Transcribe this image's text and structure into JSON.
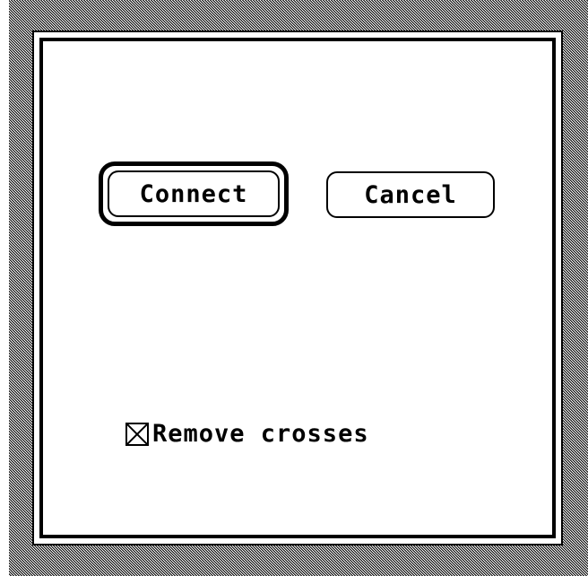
{
  "dialog": {
    "buttons": {
      "connect_label": "Connect",
      "cancel_label": "Cancel"
    },
    "checkbox": {
      "label": "Remove crosses",
      "checked": true
    }
  },
  "colors": {
    "foreground": "#000000",
    "background": "#ffffff"
  }
}
